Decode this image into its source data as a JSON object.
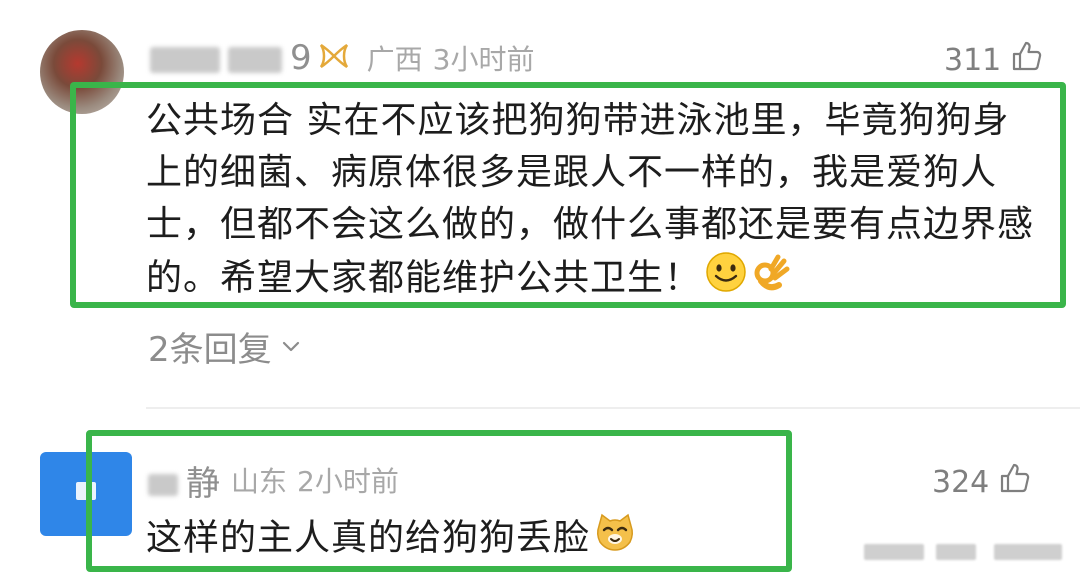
{
  "comments": [
    {
      "username_visible": "9",
      "location": "广西",
      "time": "3小时前",
      "likes": "311",
      "text": "公共场合 实在不应该把狗狗带进泳池里，毕竟狗狗身上的细菌、病原体很多是跟人不一样的，我是爱狗人士，但都不会这么做的，做什么事都还是要有点边界感的。希望大家都能维护公共卫生！",
      "emojis": [
        "smile-emoji",
        "ok-hand-emoji"
      ],
      "replies_label": "2条回复"
    },
    {
      "username_visible": "静",
      "location": "山东",
      "time": "2小时前",
      "likes": "324",
      "text": "这样的主人真的给狗狗丢脸",
      "emojis": [
        "cat-face-emoji"
      ]
    }
  ],
  "colors": {
    "highlight": "#3ab54a",
    "meta": "#a8a8a8",
    "likes": "#7f7f7f"
  }
}
